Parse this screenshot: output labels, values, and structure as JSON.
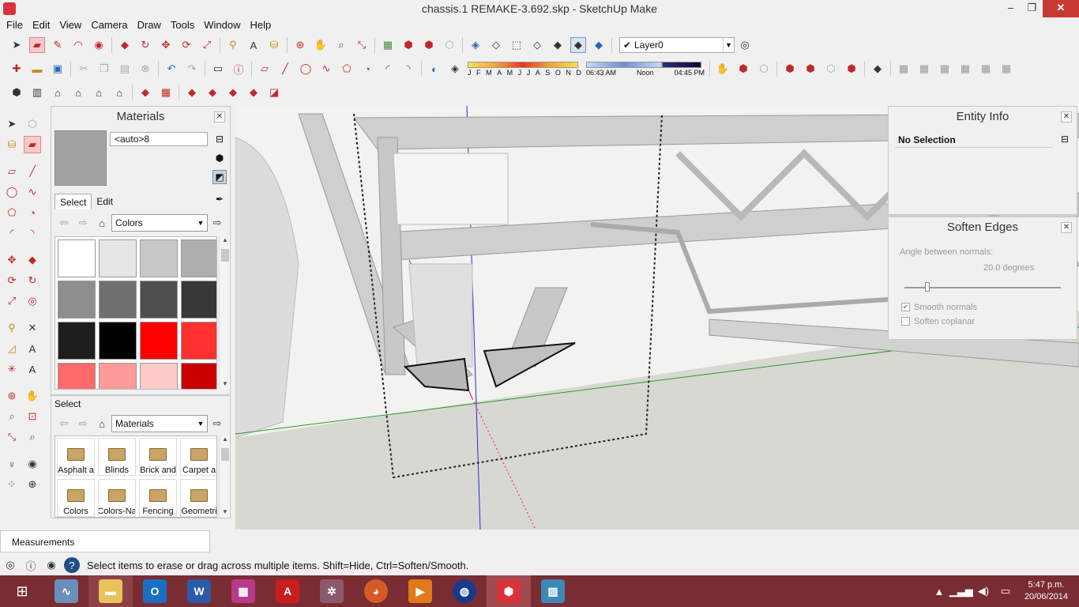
{
  "window": {
    "title": "chassis.1 REMAKE-3.692.skp - SketchUp Make",
    "minimize": "‒",
    "restore": "❐",
    "close": "✕"
  },
  "menu": [
    "File",
    "Edit",
    "View",
    "Camera",
    "Draw",
    "Tools",
    "Window",
    "Help"
  ],
  "toolbar": {
    "layer_name": "Layer0",
    "months": [
      "J",
      "F",
      "M",
      "A",
      "M",
      "J",
      "J",
      "A",
      "S",
      "O",
      "N",
      "D"
    ],
    "time_start": "06:43 AM",
    "time_mid": "Noon",
    "time_end": "04:45 PM"
  },
  "materials": {
    "title": "Materials",
    "name_value": "<auto>8",
    "tab_select": "Select",
    "tab_edit": "Edit",
    "collection": "Colors",
    "swatches": [
      "#ffffff",
      "#e6e6e6",
      "#c8c8c8",
      "#aeaeae",
      "#8e8e8e",
      "#6f6f6f",
      "#4f4f4f",
      "#383838",
      "#1e1e1e",
      "#000000",
      "#ff0000",
      "#ff3030",
      "#ff6a6a",
      "#ff9a9a",
      "#ffcaca",
      "#c80000"
    ],
    "select_label": "Select",
    "library_collection": "Materials",
    "library_items": [
      "Asphalt a",
      "Blinds",
      "Brick and",
      "Carpet a",
      "Colors",
      "Colors-Na",
      "Fencing",
      "Geometri"
    ]
  },
  "entity_info": {
    "title": "Entity Info",
    "selection": "No Selection"
  },
  "soften_edges": {
    "title": "Soften Edges",
    "angle_label": "Angle between normals:",
    "angle_value": "20.0  degrees",
    "smooth_normals": "Smooth normals",
    "soften_coplanar": "Soften coplanar"
  },
  "measurements_label": "Measurements",
  "status_text": "Select items to erase or drag across multiple items. Shift=Hide, Ctrl=Soften/Smooth.",
  "clock": {
    "time": "5:47 p.m.",
    "date": "20/06/2014"
  },
  "colors": {
    "taskbar": "#7a2c33",
    "close_button": "#c73a32"
  }
}
